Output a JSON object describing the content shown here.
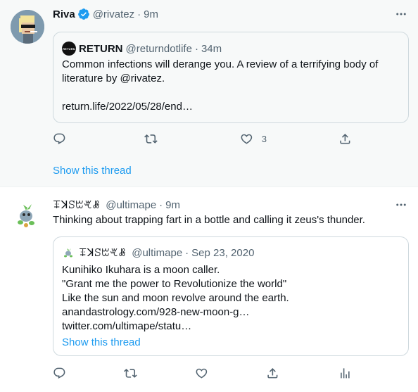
{
  "colors": {
    "accent": "#1d9bf0",
    "muted": "#536471",
    "text": "#0f1419",
    "border": "#cfd9de"
  },
  "tweet1": {
    "name": "Riva",
    "handle": "@rivatez",
    "separator": "·",
    "time": "9m",
    "verified_icon": "verified-badge-icon",
    "quote": {
      "logo_text": "RETURN",
      "name": "RETURN",
      "handle": "@returndotlife",
      "separator": "·",
      "time": "34m",
      "lines": [
        "Common infections will derange you. A review of a terrifying body of",
        "literature by @rivatez.",
        "",
        "return.life/2022/05/28/end…"
      ]
    },
    "actions": {
      "reply_icon": "reply-icon",
      "retweet_icon": "retweet-icon",
      "like_icon": "heart-icon",
      "like_count": "3",
      "share_icon": "share-icon"
    },
    "show_thread": "Show this thread"
  },
  "tweet2": {
    "name": "ꔊꓘꕶꔱꕩꗡ",
    "handle": "@ultimape",
    "separator": "·",
    "time": "9m",
    "text": "Thinking about trapping fart in a bottle and calling it zeus's thunder.",
    "quote": {
      "name": "ꔊꓘꕶꔱꕩꗡ",
      "handle": "@ultimape",
      "separator": "·",
      "time": "Sep 23, 2020",
      "lines": [
        "Kunihiko Ikuhara is a moon caller.",
        "\"Grant me the power to Revolutionize the world\"",
        "Like the sun and moon revolve around the earth.",
        "anandastrology.com/928-new-moon-g…",
        "twitter.com/ultimape/statu…"
      ],
      "show_thread": "Show this thread"
    },
    "actions": {
      "reply_icon": "reply-icon",
      "retweet_icon": "retweet-icon",
      "like_icon": "heart-icon",
      "analytics_icon": "analytics-icon"
    }
  }
}
